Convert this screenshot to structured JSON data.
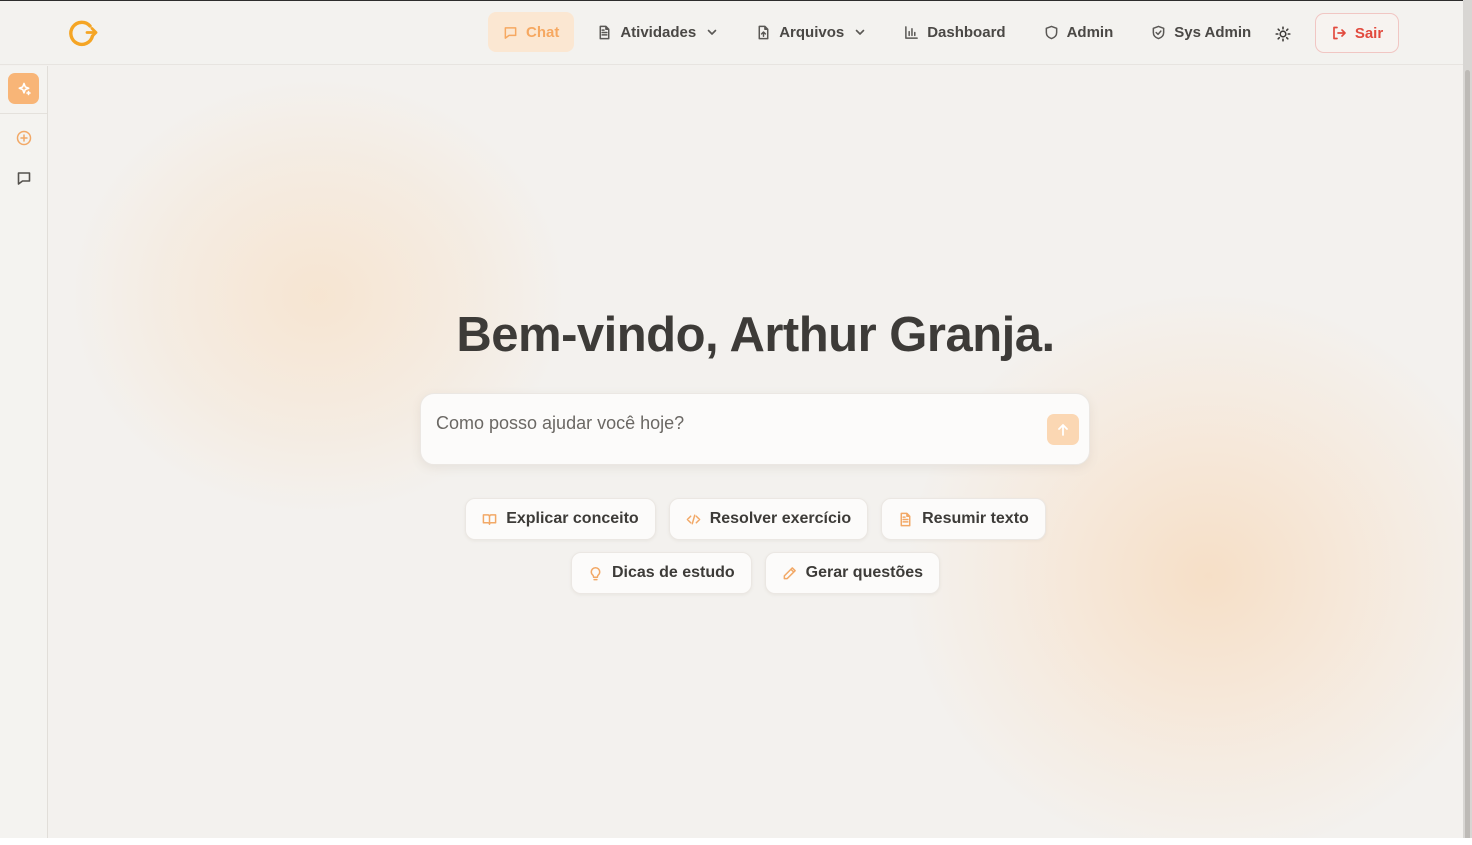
{
  "colors": {
    "accent": "#f6a861",
    "danger": "#e24a3e",
    "background": "#f3f1ee"
  },
  "nav": {
    "items": [
      {
        "label": "Chat",
        "icon": "message-icon",
        "active": true
      },
      {
        "label": "Atividades",
        "icon": "document-icon",
        "dropdown": true
      },
      {
        "label": "Arquivos",
        "icon": "file-upload-icon",
        "dropdown": true
      },
      {
        "label": "Dashboard",
        "icon": "bar-chart-icon"
      },
      {
        "label": "Admin",
        "icon": "shield-icon"
      },
      {
        "label": "Sys Admin",
        "icon": "shield-check-icon"
      }
    ],
    "logout_label": "Sair"
  },
  "main": {
    "welcome": "Bem-vindo, Arthur Granja.",
    "input_placeholder": "Como posso ajudar você hoje?",
    "suggestions_row1": [
      {
        "label": "Explicar conceito",
        "icon": "book-open-icon"
      },
      {
        "label": "Resolver exercício",
        "icon": "code-icon"
      },
      {
        "label": "Resumir texto",
        "icon": "file-text-icon"
      }
    ],
    "suggestions_row2": [
      {
        "label": "Dicas de estudo",
        "icon": "lightbulb-icon"
      },
      {
        "label": "Gerar questões",
        "icon": "pencil-icon"
      }
    ]
  }
}
